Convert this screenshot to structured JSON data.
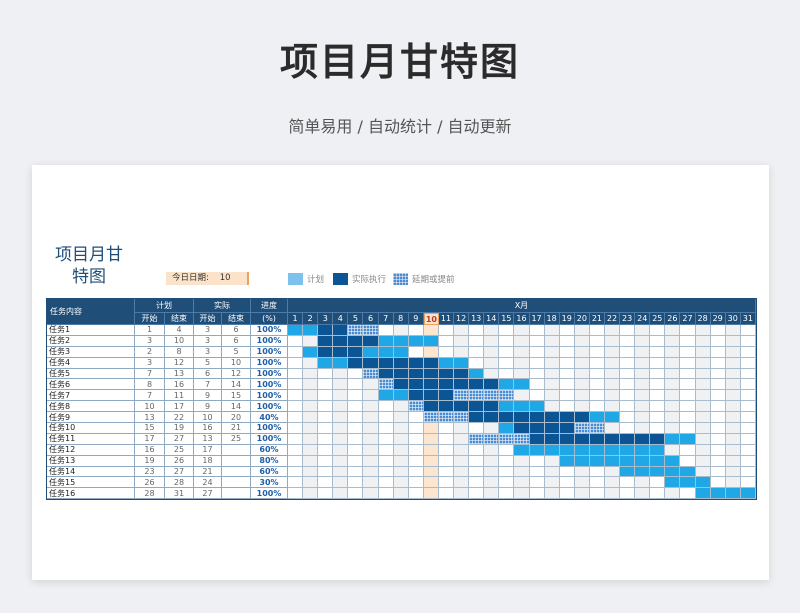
{
  "page": {
    "title": "项目月甘特图",
    "subtitle": "简单易用  /  自动统计  /  自动更新"
  },
  "sheet": {
    "title": "项目月甘特图",
    "today_label": "今日日期:",
    "today_value": "10",
    "legend": [
      {
        "label": "计划",
        "swatch": "plan"
      },
      {
        "label": "实际执行",
        "swatch": "act"
      },
      {
        "label": "延期或提前",
        "swatch": "delay"
      }
    ],
    "headers": {
      "task": "任务内容",
      "plan": "计划",
      "actual": "实际",
      "start": "开始",
      "end": "结束",
      "progress": "进度",
      "progress_unit": "(%)",
      "month": "X月"
    },
    "days": 31,
    "today": 10,
    "tasks": [
      {
        "name": "任务1",
        "ps": 1,
        "pe": 4,
        "as": 3,
        "ae": 6,
        "prog": "100%"
      },
      {
        "name": "任务2",
        "ps": 3,
        "pe": 10,
        "as": 3,
        "ae": 6,
        "prog": "100%"
      },
      {
        "name": "任务3",
        "ps": 2,
        "pe": 8,
        "as": 3,
        "ae": 5,
        "prog": "100%"
      },
      {
        "name": "任务4",
        "ps": 3,
        "pe": 12,
        "as": 5,
        "ae": 10,
        "prog": "100%"
      },
      {
        "name": "任务5",
        "ps": 7,
        "pe": 13,
        "as": 6,
        "ae": 12,
        "prog": "100%"
      },
      {
        "name": "任务6",
        "ps": 8,
        "pe": 16,
        "as": 7,
        "ae": 14,
        "prog": "100%"
      },
      {
        "name": "任务7",
        "ps": 7,
        "pe": 11,
        "as": 9,
        "ae": 15,
        "prog": "100%"
      },
      {
        "name": "任务8",
        "ps": 10,
        "pe": 17,
        "as": 9,
        "ae": 14,
        "prog": "100%"
      },
      {
        "name": "任务9",
        "ps": 13,
        "pe": 22,
        "as": 10,
        "ae": 20,
        "prog": "40%"
      },
      {
        "name": "任务10",
        "ps": 15,
        "pe": 19,
        "as": 16,
        "ae": 21,
        "prog": "100%"
      },
      {
        "name": "任务11",
        "ps": 17,
        "pe": 27,
        "as": 13,
        "ae": 25,
        "prog": "100%"
      },
      {
        "name": "任务12",
        "ps": 16,
        "pe": 25,
        "as": 17,
        "ae": "",
        "prog": "60%"
      },
      {
        "name": "任务13",
        "ps": 19,
        "pe": 26,
        "as": 18,
        "ae": "",
        "prog": "80%"
      },
      {
        "name": "任务14",
        "ps": 23,
        "pe": 27,
        "as": 21,
        "ae": "",
        "prog": "60%"
      },
      {
        "name": "任务15",
        "ps": 26,
        "pe": 28,
        "as": 24,
        "ae": "",
        "prog": "30%"
      },
      {
        "name": "任务16",
        "ps": 28,
        "pe": 31,
        "as": 27,
        "ae": "",
        "prog": "100%"
      }
    ],
    "colors": {
      "header": "#1f4e79",
      "plan": "#20a8e6",
      "actual": "#0b5595",
      "delay": "#4b8bd1",
      "today": "#fce6d0"
    }
  }
}
